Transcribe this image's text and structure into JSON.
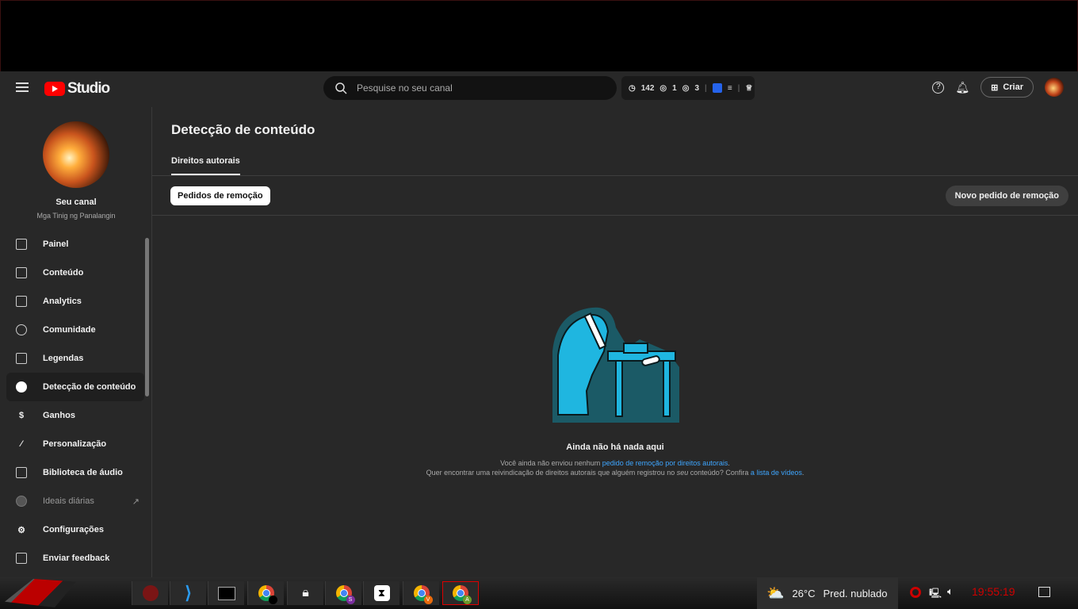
{
  "header": {
    "logo_text": "Studio",
    "search_placeholder": "Pesquise no seu canal",
    "stats": {
      "realtime": "142",
      "views_a": "1",
      "views_b": "3"
    },
    "create_label": "Criar"
  },
  "sidebar": {
    "channel_title": "Seu canal",
    "channel_name": "Mga Tinig ng Panalangin",
    "items": [
      {
        "label": "Painel",
        "icon": "dashboard-icon"
      },
      {
        "label": "Conteúdo",
        "icon": "content-icon"
      },
      {
        "label": "Analytics",
        "icon": "analytics-icon"
      },
      {
        "label": "Comunidade",
        "icon": "community-icon"
      },
      {
        "label": "Legendas",
        "icon": "subtitles-icon"
      },
      {
        "label": "Detecção de conteúdo",
        "icon": "copyright-icon",
        "active": true
      },
      {
        "label": "Ganhos",
        "icon": "dollar-icon"
      },
      {
        "label": "Personalização",
        "icon": "magic-wand-icon"
      },
      {
        "label": "Biblioteca de áudio",
        "icon": "audio-library-icon"
      },
      {
        "label": "Ideais diárias",
        "icon": "ideas-icon"
      },
      {
        "label": "Configurações",
        "icon": "gear-icon"
      },
      {
        "label": "Enviar feedback",
        "icon": "feedback-icon"
      }
    ]
  },
  "main": {
    "title": "Detecção de conteúdo",
    "tab": "Direitos autorais",
    "chip": "Pedidos de remoção",
    "new_request": "Novo pedido de remoção",
    "empty_title": "Ainda não há nada aqui",
    "line1_pre": "Você ainda não enviou nenhum ",
    "line1_link": "pedido de remoção por direitos autorais",
    "line1_post": ".",
    "line2_pre": "Quer encontrar uma reivindicação de direitos autorais que alguém registrou no ",
    "line2_em": "seu",
    "line2_mid": " conteúdo? Confira ",
    "line2_link": "a lista de vídeos",
    "line2_post": "."
  },
  "taskbar": {
    "weather_temp": "26°C",
    "weather_desc": "Pred. nublado",
    "clock": "19:55:19",
    "badges": [
      "S",
      "V",
      "A"
    ]
  },
  "colors": {
    "accent": "#3ea6ff",
    "brand": "#ff0000",
    "clock": "#d00000"
  }
}
